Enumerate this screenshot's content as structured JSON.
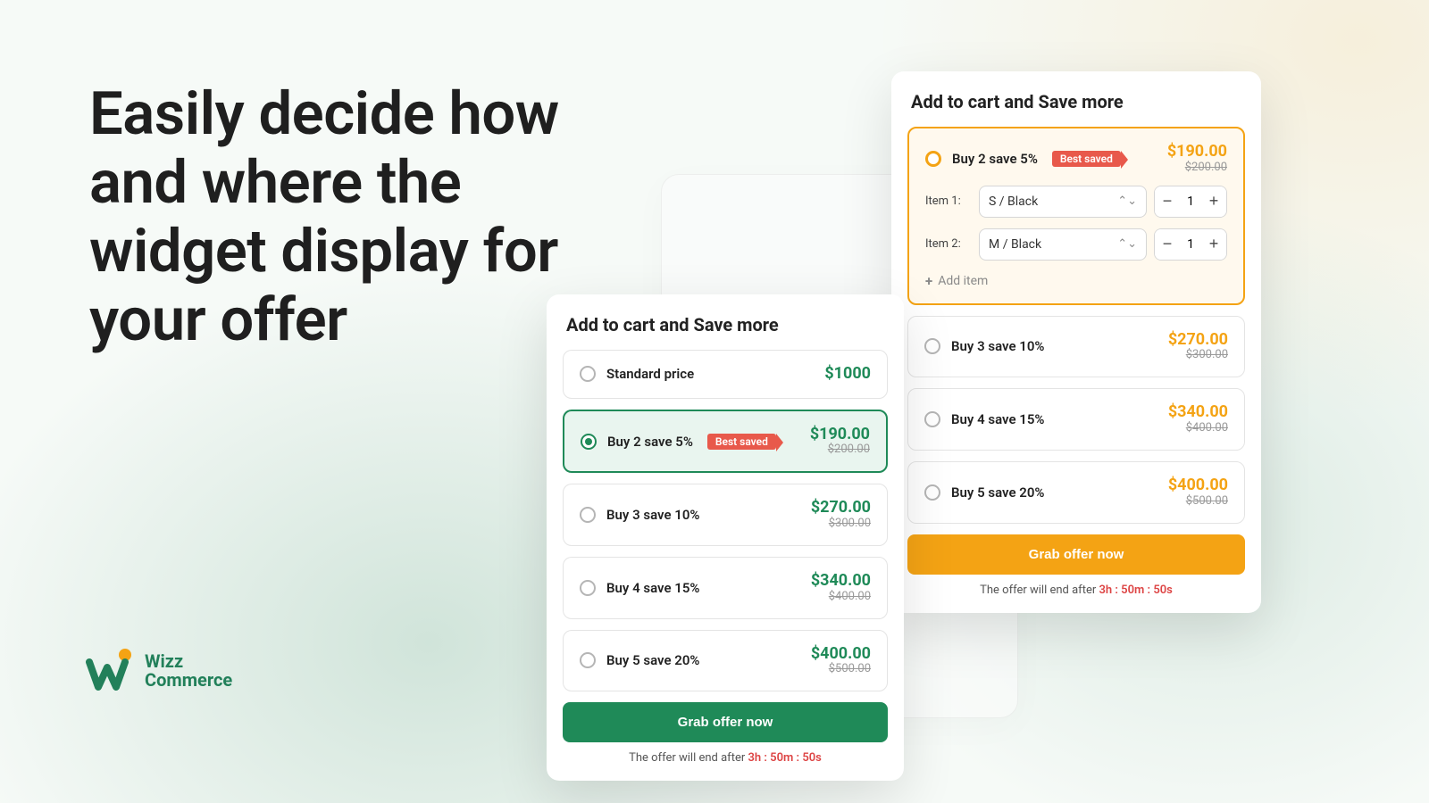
{
  "headline": "Easily decide how and where the widget display for your offer",
  "brand": {
    "name_line1": "Wizz",
    "name_line2": "Commerce"
  },
  "common": {
    "panel_title": "Add to cart and Save more",
    "cta_label": "Grab offer now",
    "timer_prefix": "The offer will end after ",
    "timer_value": "3h : 50m : 50s",
    "best_badge": "Best saved",
    "add_item": "Add item"
  },
  "card_a": {
    "tiers": [
      {
        "label": "Standard price",
        "price": "$1000"
      },
      {
        "label": "Buy 2 save 5%",
        "price": "$190.00",
        "old": "$200.00",
        "best": true
      },
      {
        "label": "Buy 3 save 10%",
        "price": "$270.00",
        "old": "$300.00"
      },
      {
        "label": "Buy 4 save 15%",
        "price": "$340.00",
        "old": "$400.00"
      },
      {
        "label": "Buy 5 save 20%",
        "price": "$400.00",
        "old": "$500.00"
      }
    ]
  },
  "card_b": {
    "selected": {
      "label": "Buy 2 save 5%",
      "price": "$190.00",
      "old": "$200.00",
      "items": [
        {
          "label": "Item 1:",
          "variant": "S / Black",
          "qty": "1"
        },
        {
          "label": "Item 2:",
          "variant": "M / Black",
          "qty": "1"
        }
      ]
    },
    "tiers": [
      {
        "label": "Buy 3 save 10%",
        "price": "$270.00",
        "old": "$300.00"
      },
      {
        "label": "Buy 4 save 15%",
        "price": "$340.00",
        "old": "$400.00"
      },
      {
        "label": "Buy 5 save 20%",
        "price": "$400.00",
        "old": "$500.00"
      }
    ]
  }
}
